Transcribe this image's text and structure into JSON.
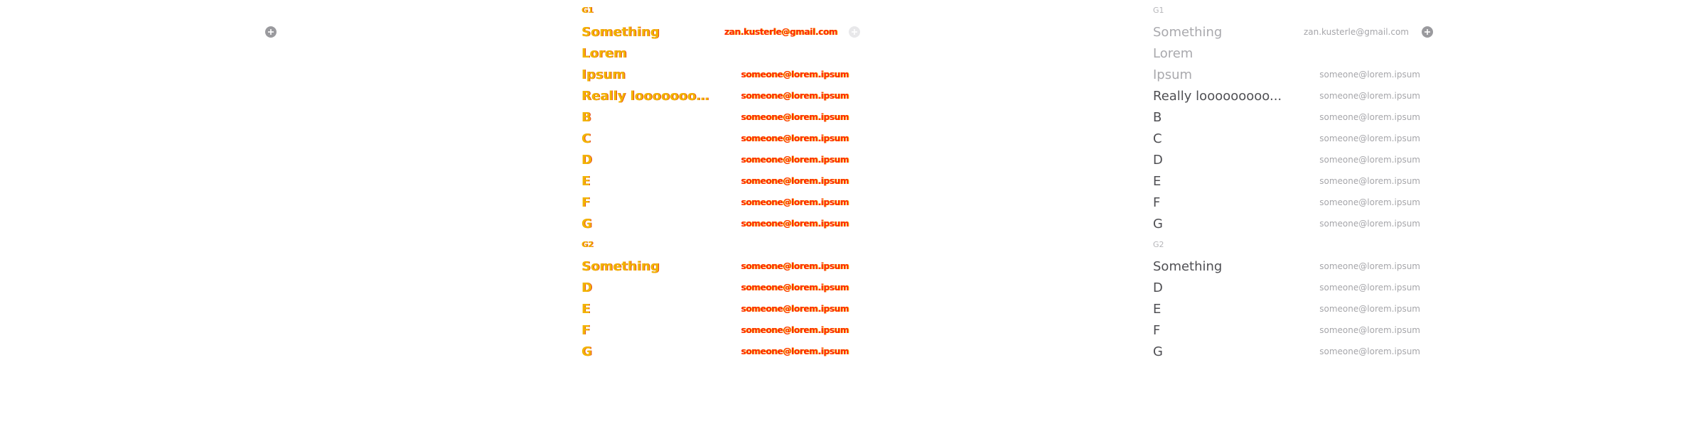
{
  "add_icon": "plus-circle-icon",
  "groups": [
    {
      "label": "G1",
      "rows": [
        {
          "name": "Something",
          "email": "zan.kusterle@gmail.com",
          "dim": true,
          "add": true
        },
        {
          "name": "Lorem",
          "email": "",
          "dim": true
        },
        {
          "name": "Ipsum",
          "email": "someone@lorem.ipsum",
          "dim": true
        },
        {
          "name": "Really looooooooo...",
          "email": "someone@lorem.ipsum",
          "dim": false
        },
        {
          "name": "B",
          "email": "someone@lorem.ipsum",
          "dim": false
        },
        {
          "name": "C",
          "email": "someone@lorem.ipsum",
          "dim": false
        },
        {
          "name": "D",
          "email": "someone@lorem.ipsum",
          "dim": false
        },
        {
          "name": "E",
          "email": "someone@lorem.ipsum",
          "dim": false
        },
        {
          "name": "F",
          "email": "someone@lorem.ipsum",
          "dim": false
        },
        {
          "name": "G",
          "email": "someone@lorem.ipsum",
          "dim": false
        }
      ]
    },
    {
      "label": "G2",
      "rows": [
        {
          "name": "Something",
          "email": "someone@lorem.ipsum",
          "dim": false
        },
        {
          "name": "D",
          "email": "someone@lorem.ipsum",
          "dim": false
        },
        {
          "name": "E",
          "email": "someone@lorem.ipsum",
          "dim": false
        },
        {
          "name": "F",
          "email": "someone@lorem.ipsum",
          "dim": false
        },
        {
          "name": "G",
          "email": "someone@lorem.ipsum",
          "dim": false
        }
      ]
    }
  ]
}
